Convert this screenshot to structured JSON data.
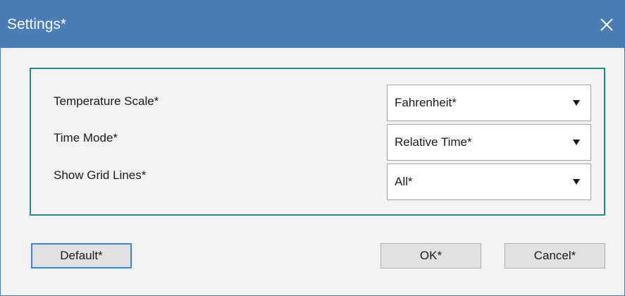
{
  "window": {
    "title": "Settings*",
    "close_icon": "close-icon"
  },
  "settings": {
    "rows": [
      {
        "label": "Temperature Scale*",
        "value": "Fahrenheit*"
      },
      {
        "label": "Time Mode*",
        "value": "Relative Time*"
      },
      {
        "label": "Show Grid Lines*",
        "value": "All*"
      }
    ]
  },
  "buttons": {
    "default_label": "Default*",
    "ok_label": "OK*",
    "cancel_label": "Cancel*"
  },
  "colors": {
    "titlebar": "#4a7db5",
    "group_border": "#1f8a86",
    "focus_border": "#3c86d8"
  }
}
